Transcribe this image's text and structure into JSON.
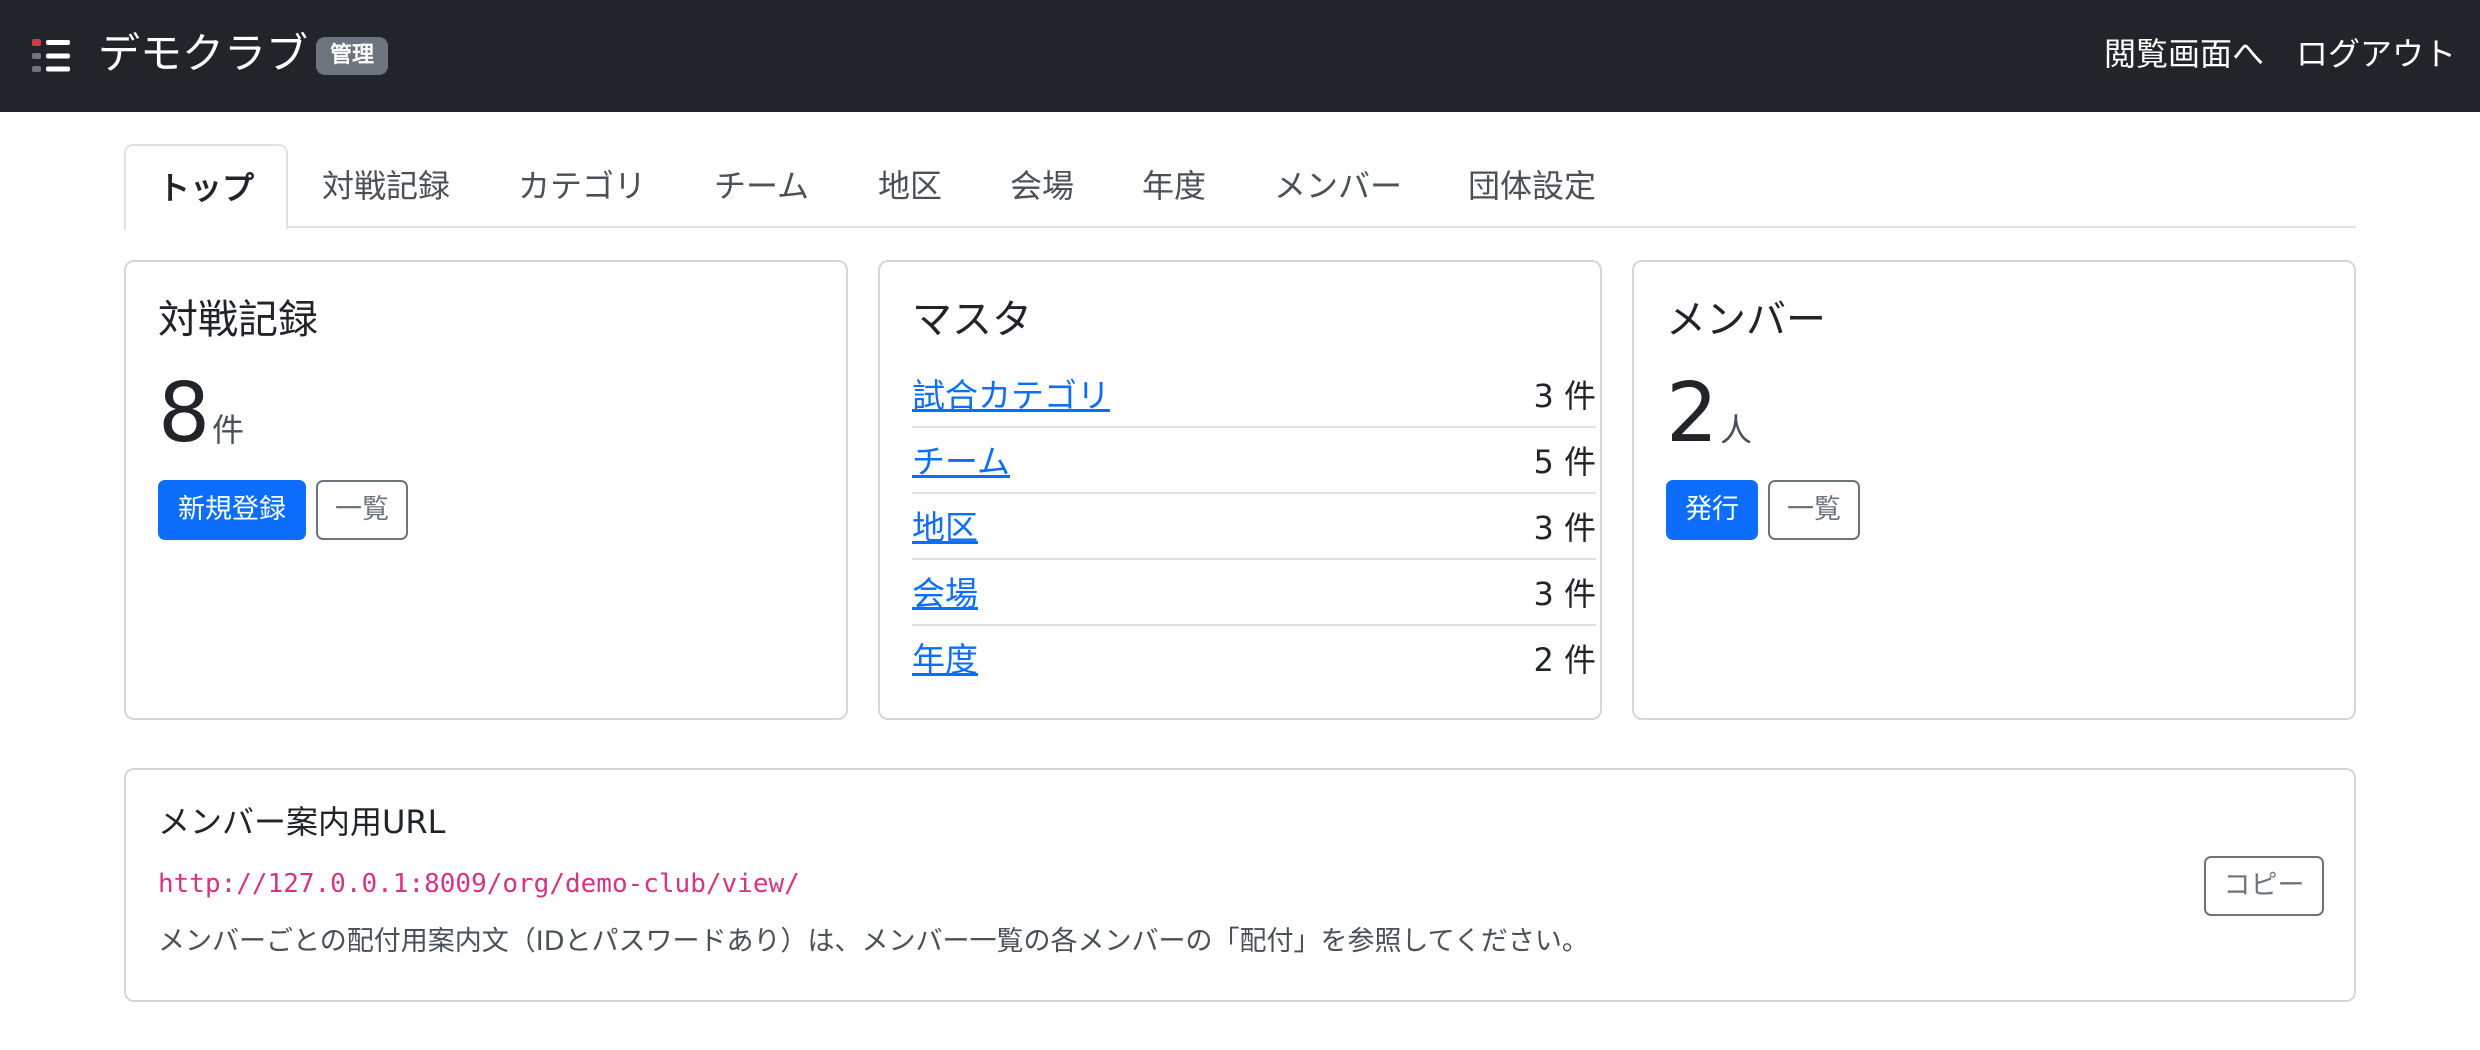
{
  "navbar": {
    "brand_icon": "list-with-red-dot-icon",
    "brand_name": "デモクラブ",
    "badge": "管理",
    "links": {
      "view": "閲覧画面へ",
      "logout": "ログアウト"
    }
  },
  "tabs": [
    {
      "label": "トップ",
      "active": true
    },
    {
      "label": "対戦記録"
    },
    {
      "label": "カテゴリ"
    },
    {
      "label": "チーム"
    },
    {
      "label": "地区"
    },
    {
      "label": "会場"
    },
    {
      "label": "年度"
    },
    {
      "label": "メンバー"
    },
    {
      "label": "団体設定"
    }
  ],
  "records_card": {
    "title": "対戦記録",
    "count": "8",
    "unit": "件",
    "new_button": "新規登録",
    "list_button": "一覧"
  },
  "master_card": {
    "title": "マスタ",
    "items": [
      {
        "label": "試合カテゴリ",
        "count": "3 件"
      },
      {
        "label": "チーム",
        "count": "5 件"
      },
      {
        "label": "地区",
        "count": "3 件"
      },
      {
        "label": "会場",
        "count": "3 件"
      },
      {
        "label": "年度",
        "count": "2 件"
      }
    ]
  },
  "members_card": {
    "title": "メンバー",
    "count": "2",
    "unit": "人",
    "issue_button": "発行",
    "list_button": "一覧"
  },
  "url_card": {
    "title": "メンバー案内用URL",
    "url": "http://127.0.0.1:8009/org/demo-club/view/",
    "copy_button": "コピー",
    "note": "メンバーごとの配付用案内文（IDとパスワードあり）は、メンバー一覧の各メンバーの「配付」を参照してください。"
  },
  "colors": {
    "navbar_bg": "#212529",
    "primary": "#0d6efd",
    "secondary": "#6c757d",
    "code": "#d63384"
  }
}
